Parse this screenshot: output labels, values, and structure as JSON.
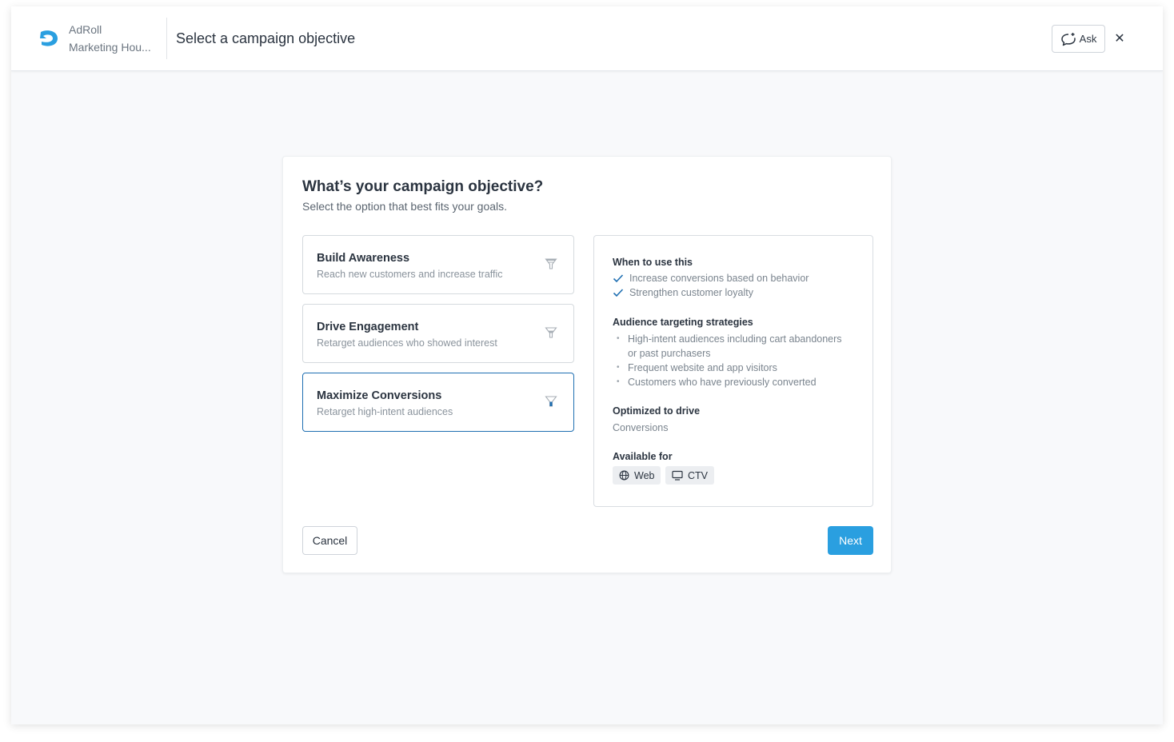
{
  "header": {
    "org_line1": "AdRoll",
    "org_line2": "Marketing Hou...",
    "title": "Select a campaign objective",
    "ask_label": "Ask",
    "close_glyph": "✕",
    "brand_color": "#2a9fe0"
  },
  "card": {
    "title": "What’s your campaign objective?",
    "subtitle": "Select the option that best fits your goals.",
    "options": [
      {
        "title": "Build Awareness",
        "desc": "Reach new customers and increase traffic",
        "icon": "funnel-top-icon",
        "selected": false
      },
      {
        "title": "Drive Engagement",
        "desc": "Retarget audiences who showed interest",
        "icon": "funnel-middle-icon",
        "selected": false
      },
      {
        "title": "Maximize Conversions",
        "desc": "Retarget high-intent audiences",
        "icon": "funnel-bottom-icon",
        "selected": true
      }
    ],
    "details": {
      "when_heading": "When to use this",
      "when_items": [
        "Increase conversions based on behavior",
        "Strengthen customer loyalty"
      ],
      "strategies_heading": "Audience targeting strategies",
      "strategies": [
        "High-intent audiences including cart abandoners or past purchasers",
        "Frequent website and app visitors",
        "Customers who have previously converted"
      ],
      "optimized_heading": "Optimized to drive",
      "optimized_value": "Conversions",
      "available_heading": "Available for",
      "channels": [
        {
          "label": "Web",
          "icon": "globe-icon"
        },
        {
          "label": "CTV",
          "icon": "monitor-icon"
        }
      ]
    },
    "cancel_label": "Cancel",
    "next_label": "Next"
  }
}
